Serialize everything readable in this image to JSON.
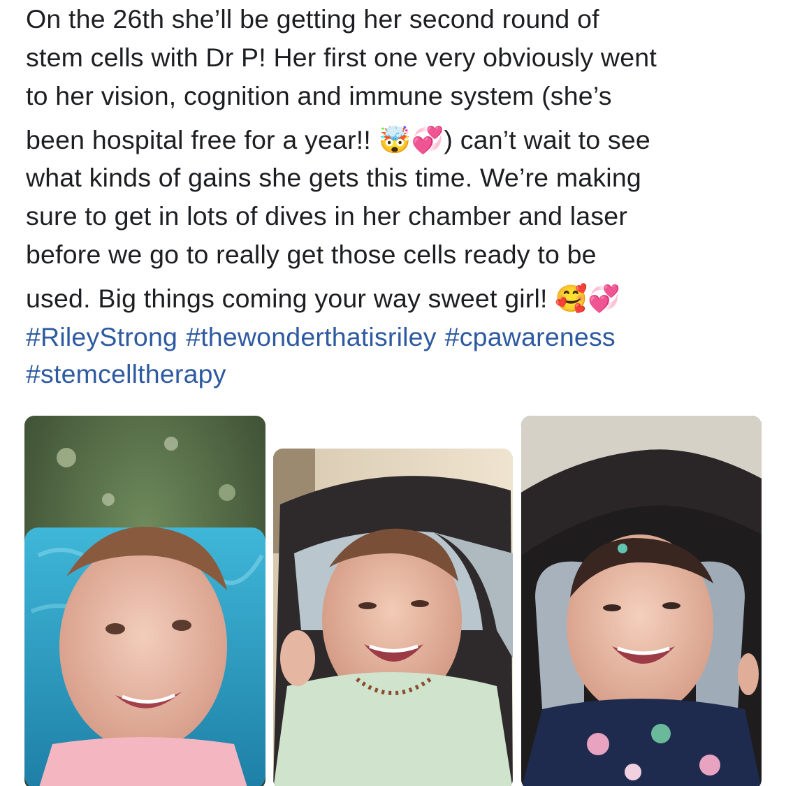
{
  "post": {
    "lines": [
      "On the 26th she’ll be getting her second round of",
      "stem cells with Dr P! Her first one very obviously went",
      "to her vision, cognition and immune system (she’s",
      "been hospital free for a year!! 🤯💞) can’t wait to see",
      "what kinds of gains she gets this time. We’re making",
      "sure to get in lots of dives in her chamber and laser",
      "before we go to really get those cells ready to be",
      "used. Big things coming your way sweet girl! 🥰💞"
    ],
    "hashtags": [
      "#RileyStrong",
      "#thewonderthatisriley",
      "#cpawareness",
      "#stemcelltherapy"
    ]
  },
  "colors": {
    "text": "#1c1e21",
    "hashtag": "#2d5aa0",
    "background": "#ffffff"
  }
}
